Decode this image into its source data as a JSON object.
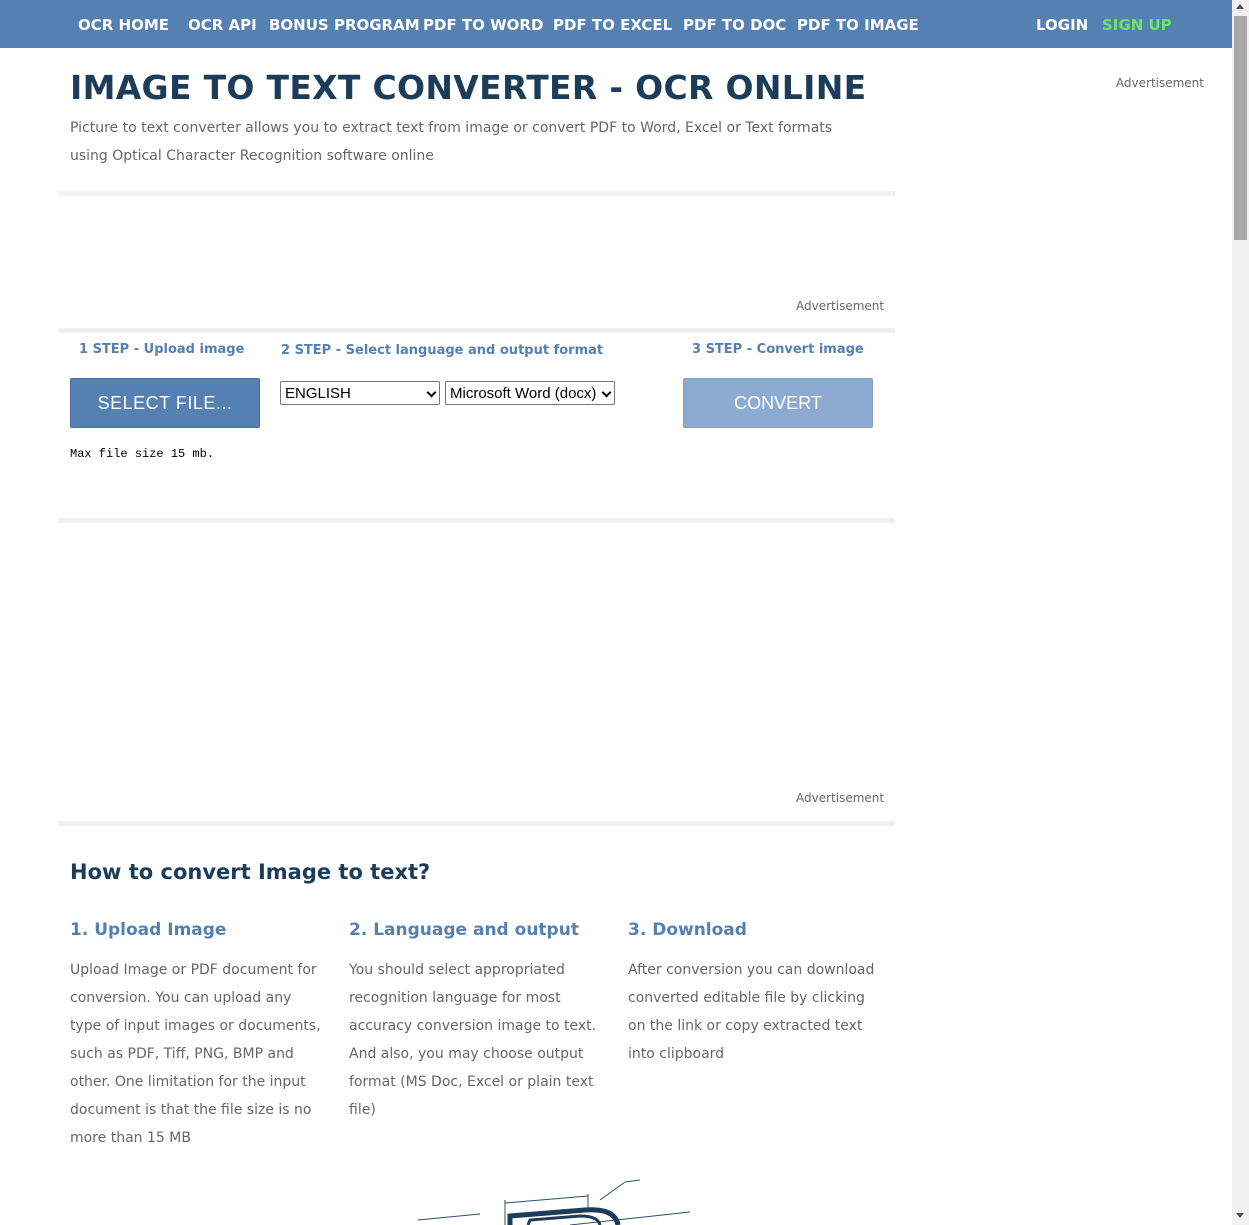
{
  "nav": {
    "items": [
      {
        "label": "OCR HOME"
      },
      {
        "label": "OCR API"
      },
      {
        "label": "BONUS PROGRAM"
      },
      {
        "label": "PDF TO WORD"
      },
      {
        "label": "PDF TO EXCEL"
      },
      {
        "label": "PDF TO DOC"
      },
      {
        "label": "PDF TO IMAGE"
      }
    ],
    "login": "LOGIN",
    "signup": "SIGN UP"
  },
  "side_ad_label": "Advertisement",
  "header": {
    "title": "IMAGE TO TEXT CONVERTER - OCR ONLINE",
    "subtitle": "Picture to text converter allows you to extract text from image or convert PDF to Word, Excel or Text formats using Optical Character Recognition software online"
  },
  "ads": {
    "top_label": "Advertisement",
    "bottom_label": "Advertisement"
  },
  "steps": {
    "step1_title": "1 STEP - Upload image",
    "step2_title": "2 STEP - Select language and output format",
    "step3_title": "3 STEP - Convert image",
    "select_file_label": "SELECT FILE...",
    "convert_label": "CONVERT",
    "language_selected": "ENGLISH",
    "format_selected": "Microsoft Word (docx)",
    "max_size_note": "Max file size 15 mb."
  },
  "howto": {
    "title": "How to convert Image to text?",
    "columns": [
      {
        "title": "1. Upload Image",
        "text": "Upload Image or PDF document for conversion. You can upload any type of input images or documents, such as PDF, Tiff, PNG, BMP and other. One limitation for the input document is that the file size is no more than 15 MB"
      },
      {
        "title": "2. Language and output",
        "text": "You should select appropriated recognition language for most accuracy conversion image to text. And also, you may choose output format (MS Doc, Excel or plain text file)"
      },
      {
        "title": "3. Download",
        "text": "After conversion you can download converted editable file by clicking on the link or copy extracted text into clipboard"
      }
    ]
  },
  "colors": {
    "nav_bg": "#5580b2",
    "title": "#1c3d5a",
    "accent": "#5580b2",
    "signup": "#6ee36e",
    "convert_disabled": "#8dabd2"
  }
}
